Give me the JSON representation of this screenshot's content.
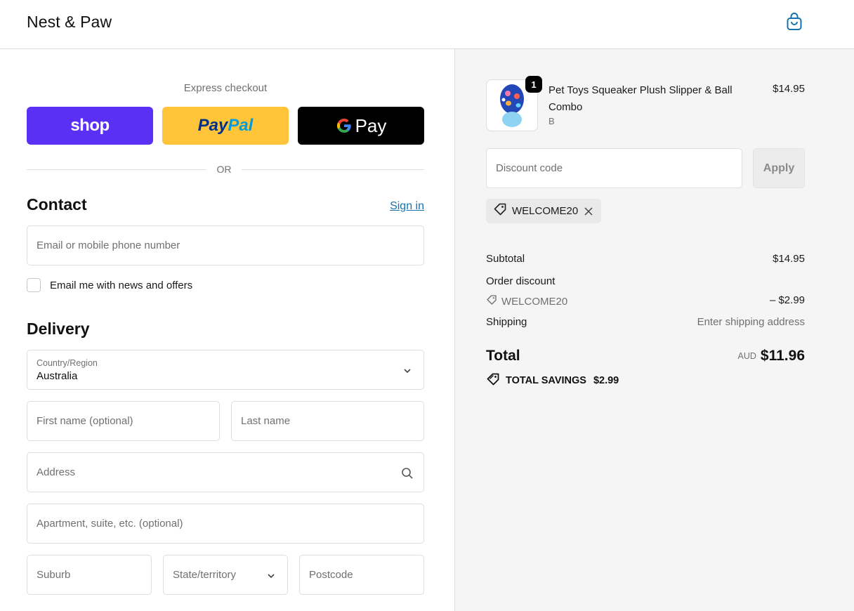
{
  "header": {
    "brand": "Nest & Paw",
    "cart_icon": "shopping-bag-icon"
  },
  "express": {
    "label": "Express checkout",
    "shop_label": "shop",
    "paypal_part1": "Pay",
    "paypal_part2": "Pal",
    "gpay_label": "Pay",
    "or_label": "OR"
  },
  "contact": {
    "title": "Contact",
    "signin_label": "Sign in",
    "email_placeholder": "Email or mobile phone number",
    "newsletter_label": "Email me with news and offers"
  },
  "delivery": {
    "title": "Delivery",
    "country_label": "Country/Region",
    "country_value": "Australia",
    "first_name_placeholder": "First name (optional)",
    "last_name_placeholder": "Last name",
    "address_placeholder": "Address",
    "apartment_placeholder": "Apartment, suite, etc. (optional)",
    "suburb_placeholder": "Suburb",
    "state_placeholder": "State/territory",
    "postcode_placeholder": "Postcode"
  },
  "order": {
    "item": {
      "name": "Pet Toys Squeaker Plush Slipper & Ball Combo",
      "variant": "B",
      "price": "$14.95",
      "quantity": "1"
    },
    "discount_placeholder": "Discount code",
    "apply_label": "Apply",
    "applied_code": "WELCOME20",
    "subtotal_label": "Subtotal",
    "subtotal_value": "$14.95",
    "order_discount_label": "Order discount",
    "discount_code": "WELCOME20",
    "discount_value": "– $2.99",
    "shipping_label": "Shipping",
    "shipping_value": "Enter shipping address",
    "total_label": "Total",
    "currency": "AUD",
    "total_value": "$11.96",
    "savings_label": "TOTAL SAVINGS",
    "savings_value": "$2.99"
  },
  "colors": {
    "shop_purple": "#5a31f4",
    "paypal_yellow": "#ffc439",
    "link_blue": "#1773b0",
    "summary_bg": "#f5f5f5"
  }
}
